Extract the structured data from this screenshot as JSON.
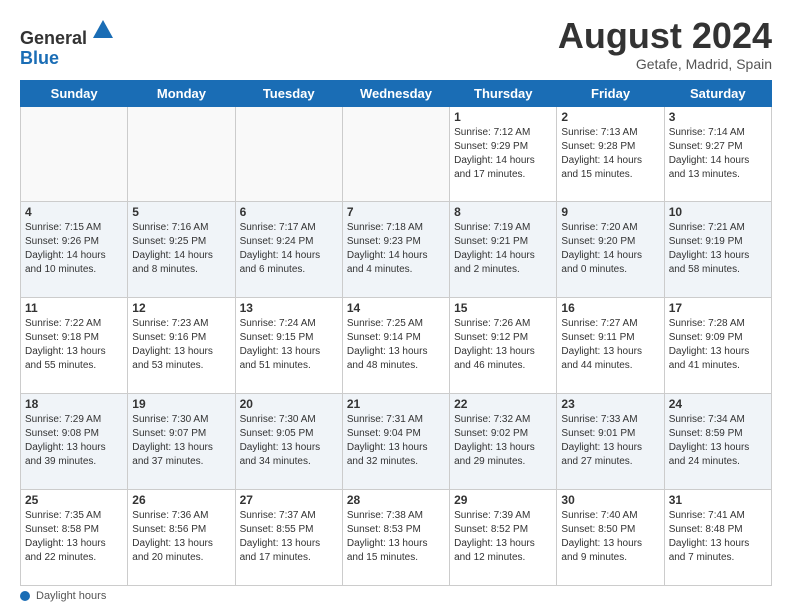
{
  "header": {
    "logo_general": "General",
    "logo_blue": "Blue",
    "month_title": "August 2024",
    "location": "Getafe, Madrid, Spain"
  },
  "footer": {
    "label": "Daylight hours"
  },
  "days_of_week": [
    "Sunday",
    "Monday",
    "Tuesday",
    "Wednesday",
    "Thursday",
    "Friday",
    "Saturday"
  ],
  "weeks": [
    [
      {
        "day": "",
        "info": ""
      },
      {
        "day": "",
        "info": ""
      },
      {
        "day": "",
        "info": ""
      },
      {
        "day": "",
        "info": ""
      },
      {
        "day": "1",
        "info": "Sunrise: 7:12 AM\nSunset: 9:29 PM\nDaylight: 14 hours\nand 17 minutes."
      },
      {
        "day": "2",
        "info": "Sunrise: 7:13 AM\nSunset: 9:28 PM\nDaylight: 14 hours\nand 15 minutes."
      },
      {
        "day": "3",
        "info": "Sunrise: 7:14 AM\nSunset: 9:27 PM\nDaylight: 14 hours\nand 13 minutes."
      }
    ],
    [
      {
        "day": "4",
        "info": "Sunrise: 7:15 AM\nSunset: 9:26 PM\nDaylight: 14 hours\nand 10 minutes."
      },
      {
        "day": "5",
        "info": "Sunrise: 7:16 AM\nSunset: 9:25 PM\nDaylight: 14 hours\nand 8 minutes."
      },
      {
        "day": "6",
        "info": "Sunrise: 7:17 AM\nSunset: 9:24 PM\nDaylight: 14 hours\nand 6 minutes."
      },
      {
        "day": "7",
        "info": "Sunrise: 7:18 AM\nSunset: 9:23 PM\nDaylight: 14 hours\nand 4 minutes."
      },
      {
        "day": "8",
        "info": "Sunrise: 7:19 AM\nSunset: 9:21 PM\nDaylight: 14 hours\nand 2 minutes."
      },
      {
        "day": "9",
        "info": "Sunrise: 7:20 AM\nSunset: 9:20 PM\nDaylight: 14 hours\nand 0 minutes."
      },
      {
        "day": "10",
        "info": "Sunrise: 7:21 AM\nSunset: 9:19 PM\nDaylight: 13 hours\nand 58 minutes."
      }
    ],
    [
      {
        "day": "11",
        "info": "Sunrise: 7:22 AM\nSunset: 9:18 PM\nDaylight: 13 hours\nand 55 minutes."
      },
      {
        "day": "12",
        "info": "Sunrise: 7:23 AM\nSunset: 9:16 PM\nDaylight: 13 hours\nand 53 minutes."
      },
      {
        "day": "13",
        "info": "Sunrise: 7:24 AM\nSunset: 9:15 PM\nDaylight: 13 hours\nand 51 minutes."
      },
      {
        "day": "14",
        "info": "Sunrise: 7:25 AM\nSunset: 9:14 PM\nDaylight: 13 hours\nand 48 minutes."
      },
      {
        "day": "15",
        "info": "Sunrise: 7:26 AM\nSunset: 9:12 PM\nDaylight: 13 hours\nand 46 minutes."
      },
      {
        "day": "16",
        "info": "Sunrise: 7:27 AM\nSunset: 9:11 PM\nDaylight: 13 hours\nand 44 minutes."
      },
      {
        "day": "17",
        "info": "Sunrise: 7:28 AM\nSunset: 9:09 PM\nDaylight: 13 hours\nand 41 minutes."
      }
    ],
    [
      {
        "day": "18",
        "info": "Sunrise: 7:29 AM\nSunset: 9:08 PM\nDaylight: 13 hours\nand 39 minutes."
      },
      {
        "day": "19",
        "info": "Sunrise: 7:30 AM\nSunset: 9:07 PM\nDaylight: 13 hours\nand 37 minutes."
      },
      {
        "day": "20",
        "info": "Sunrise: 7:30 AM\nSunset: 9:05 PM\nDaylight: 13 hours\nand 34 minutes."
      },
      {
        "day": "21",
        "info": "Sunrise: 7:31 AM\nSunset: 9:04 PM\nDaylight: 13 hours\nand 32 minutes."
      },
      {
        "day": "22",
        "info": "Sunrise: 7:32 AM\nSunset: 9:02 PM\nDaylight: 13 hours\nand 29 minutes."
      },
      {
        "day": "23",
        "info": "Sunrise: 7:33 AM\nSunset: 9:01 PM\nDaylight: 13 hours\nand 27 minutes."
      },
      {
        "day": "24",
        "info": "Sunrise: 7:34 AM\nSunset: 8:59 PM\nDaylight: 13 hours\nand 24 minutes."
      }
    ],
    [
      {
        "day": "25",
        "info": "Sunrise: 7:35 AM\nSunset: 8:58 PM\nDaylight: 13 hours\nand 22 minutes."
      },
      {
        "day": "26",
        "info": "Sunrise: 7:36 AM\nSunset: 8:56 PM\nDaylight: 13 hours\nand 20 minutes."
      },
      {
        "day": "27",
        "info": "Sunrise: 7:37 AM\nSunset: 8:55 PM\nDaylight: 13 hours\nand 17 minutes."
      },
      {
        "day": "28",
        "info": "Sunrise: 7:38 AM\nSunset: 8:53 PM\nDaylight: 13 hours\nand 15 minutes."
      },
      {
        "day": "29",
        "info": "Sunrise: 7:39 AM\nSunset: 8:52 PM\nDaylight: 13 hours\nand 12 minutes."
      },
      {
        "day": "30",
        "info": "Sunrise: 7:40 AM\nSunset: 8:50 PM\nDaylight: 13 hours\nand 9 minutes."
      },
      {
        "day": "31",
        "info": "Sunrise: 7:41 AM\nSunset: 8:48 PM\nDaylight: 13 hours\nand 7 minutes."
      }
    ]
  ]
}
